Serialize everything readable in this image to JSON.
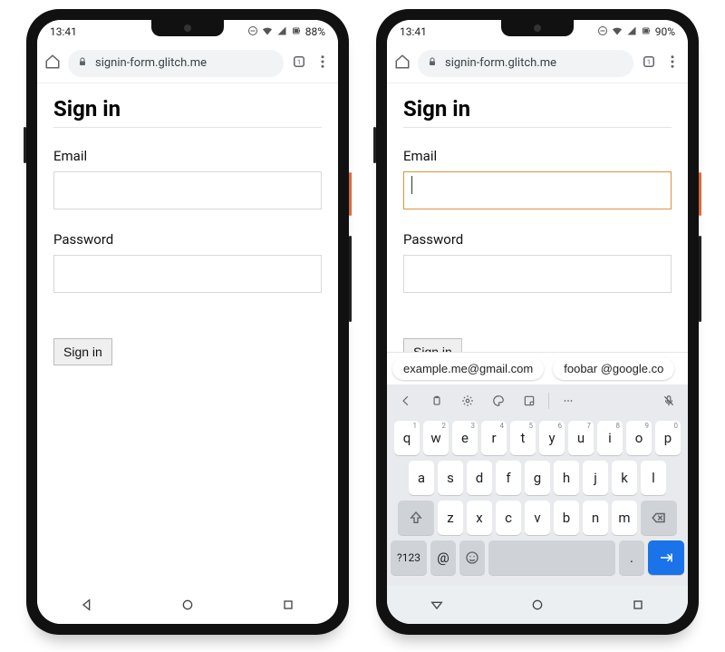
{
  "left": {
    "status": {
      "time": "13:41",
      "battery": "88%"
    },
    "url": "signin-form.glitch.me",
    "page": {
      "heading": "Sign in",
      "email_label": "Email",
      "email_value": "",
      "password_label": "Password",
      "password_value": "",
      "submit_label": "Sign in"
    }
  },
  "right": {
    "status": {
      "time": "13:41",
      "battery": "90%"
    },
    "url": "signin-form.glitch.me",
    "page": {
      "heading": "Sign in",
      "email_label": "Email",
      "email_value": "",
      "password_label": "Password",
      "password_value": "",
      "submit_label": "Sign in"
    },
    "suggestions": [
      "example.me@gmail.com",
      "foobar @google.co"
    ],
    "keyboard": {
      "row1": [
        "q",
        "w",
        "e",
        "r",
        "t",
        "y",
        "u",
        "i",
        "o",
        "p"
      ],
      "row1_hints": [
        "1",
        "2",
        "3",
        "4",
        "5",
        "6",
        "7",
        "8",
        "9",
        "0"
      ],
      "row2": [
        "a",
        "s",
        "d",
        "f",
        "g",
        "h",
        "j",
        "k",
        "l"
      ],
      "row3": [
        "z",
        "x",
        "c",
        "v",
        "b",
        "n",
        "m"
      ],
      "sym_label": "?123",
      "at_label": "@",
      "period_label": "."
    }
  }
}
